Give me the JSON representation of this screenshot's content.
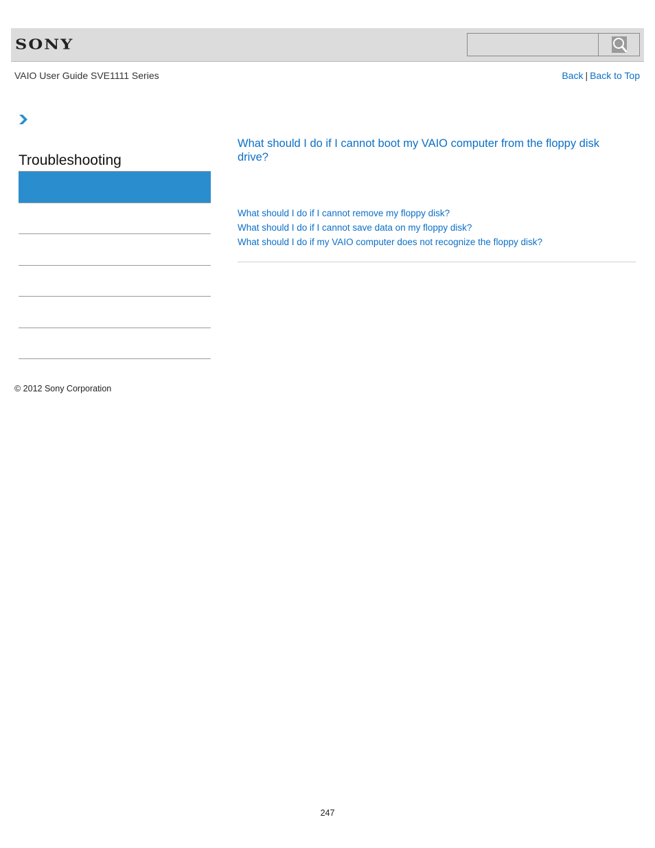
{
  "header": {
    "logo": "SONY",
    "search": {
      "placeholder": "",
      "value": "",
      "button_icon": "search-icon"
    }
  },
  "subheader": {
    "guide_title": "VAIO User Guide SVE1111 Series",
    "nav": {
      "back_label": "Back",
      "separator": "|",
      "back_to_top_label": "Back to Top"
    }
  },
  "breadcrumb": {
    "icon": "chevron-right-icon"
  },
  "sidebar": {
    "title": "Troubleshooting",
    "active_color": "#2a8dcd",
    "items": [
      "",
      "",
      "",
      "",
      "",
      ""
    ]
  },
  "main": {
    "title": "What should I do if I cannot boot my VAIO computer from the floppy disk drive?",
    "related_links": [
      "What should I do if I cannot remove my floppy disk?",
      "What should I do if I cannot save data on my floppy disk?",
      "What should I do if my VAIO computer does not recognize the floppy disk?"
    ]
  },
  "footer": {
    "copyright": "© 2012 Sony Corporation",
    "page_number": "247"
  },
  "colors": {
    "link": "#0b6fc7",
    "header_bg": "#dcdcdc",
    "accent": "#2a8dcd"
  }
}
